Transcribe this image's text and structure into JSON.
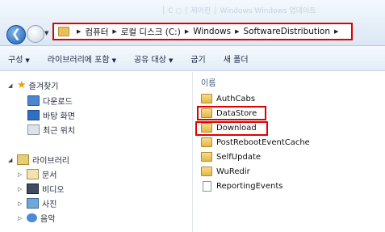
{
  "address_bar": {
    "ghost_text": "│ C ○ │  제어판  │  Windows  Windows 업데이트",
    "breadcrumbs": [
      "컴퓨터",
      "로컬 디스크 (C:)",
      "Windows",
      "SoftwareDistribution"
    ]
  },
  "toolbar": {
    "organize": "구성",
    "include_in_library": "라이브러리에 포함",
    "share_with": "공유 대상",
    "burn": "굽기",
    "new_folder": "새 폴더"
  },
  "nav_pane": {
    "favorites": {
      "label": "즐겨찾기",
      "items": [
        "다운로드",
        "바탕 화면",
        "최근 위치"
      ]
    },
    "libraries": {
      "label": "라이브러리",
      "items": [
        "문서",
        "비디오",
        "사진",
        "음악"
      ]
    }
  },
  "content": {
    "column_header": "이름",
    "files": [
      {
        "name": "AuthCabs",
        "type": "folder"
      },
      {
        "name": "DataStore",
        "type": "folder"
      },
      {
        "name": "Download",
        "type": "folder"
      },
      {
        "name": "PostRebootEventCache",
        "type": "folder"
      },
      {
        "name": "SelfUpdate",
        "type": "folder"
      },
      {
        "name": "WuRedir",
        "type": "folder"
      },
      {
        "name": "ReportingEvents",
        "type": "file"
      }
    ]
  },
  "colors": {
    "highlight": "#e00000",
    "toolbar_bg": "#e3ecf7",
    "folder": "#e3b746"
  }
}
